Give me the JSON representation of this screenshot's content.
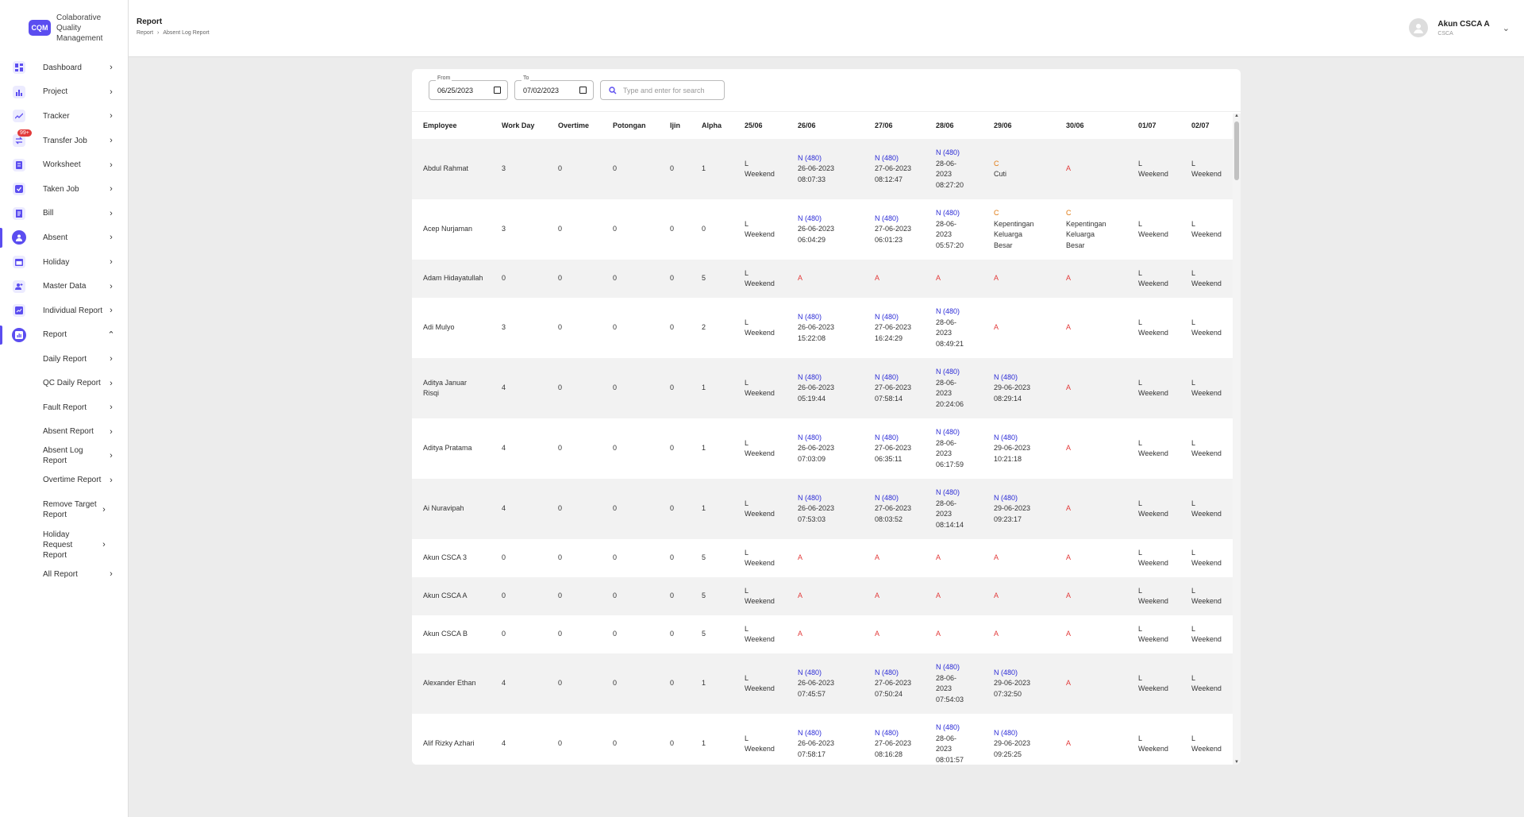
{
  "brand": {
    "logo": "CQM",
    "name_line1": "Colaborative",
    "name_line2": "Quality",
    "name_line3": "Management"
  },
  "menu": [
    {
      "label": "Dashboard",
      "icon": "dashboard-icon"
    },
    {
      "label": "Project",
      "icon": "bar-chart-icon"
    },
    {
      "label": "Tracker",
      "icon": "trend-line-icon"
    },
    {
      "label": "Transfer Job",
      "icon": "transfer-icon",
      "badge": "99+"
    },
    {
      "label": "Worksheet",
      "icon": "worksheet-icon"
    },
    {
      "label": "Taken Job",
      "icon": "check-box-icon"
    },
    {
      "label": "Bill",
      "icon": "bill-icon"
    },
    {
      "label": "Absent",
      "icon": "absent-icon"
    },
    {
      "label": "Holiday",
      "icon": "calendar-icon"
    },
    {
      "label": "Master Data",
      "icon": "add-user-icon"
    },
    {
      "label": "Individual Report",
      "icon": "individual-report-icon"
    },
    {
      "label": "Report",
      "icon": "report-icon"
    }
  ],
  "report_submenu": [
    "Daily Report",
    "QC Daily Report",
    "Fault Report",
    "Absent Report",
    "Absent Log Report",
    "Overtime Report",
    "Remove Target Report",
    "Holiday Request Report",
    "All Report"
  ],
  "header": {
    "title": "Report",
    "crumb1": "Report",
    "crumb_sep": "›",
    "crumb2": "Absent Log Report"
  },
  "user": {
    "name": "Akun CSCA A",
    "role": "CSCA"
  },
  "filters": {
    "from_label": "From",
    "from_value": "06/25/2023",
    "to_label": "To",
    "to_value": "07/02/2023",
    "search_placeholder": "Type and enter for search"
  },
  "table": {
    "columns": [
      "Employee",
      "Work Day",
      "Overtime",
      "Potongan",
      "Ijin",
      "Alpha",
      "25/06",
      "26/06",
      "27/06",
      "28/06",
      "29/06",
      "30/06",
      "01/07",
      "02/07"
    ],
    "rows": [
      {
        "name": "Abdul Rahmat",
        "work": "3",
        "ot": "0",
        "pot": "0",
        "ijin": "0",
        "alpha": "1",
        "days": [
          [
            "L",
            "Weekend"
          ],
          [
            "N (480)",
            "26-06-2023",
            "08:07:33"
          ],
          [
            "N (480)",
            "27-06-2023",
            "08:12:47"
          ],
          [
            "N (480)",
            "28-06-",
            "2023",
            "08:27:20"
          ],
          [
            "C",
            "Cuti"
          ],
          [
            "A"
          ],
          [
            "L",
            "Weekend"
          ],
          [
            "L",
            "Weekend"
          ]
        ]
      },
      {
        "name": "Acep Nurjaman",
        "work": "3",
        "ot": "0",
        "pot": "0",
        "ijin": "0",
        "alpha": "0",
        "days": [
          [
            "L",
            "Weekend"
          ],
          [
            "N (480)",
            "26-06-2023",
            "06:04:29"
          ],
          [
            "N (480)",
            "27-06-2023",
            "06:01:23"
          ],
          [
            "N (480)",
            "28-06-",
            "2023",
            "05:57:20"
          ],
          [
            "C",
            "Kepentingan",
            "Keluarga",
            "Besar"
          ],
          [
            "C",
            "Kepentingan",
            "Keluarga",
            "Besar"
          ],
          [
            "L",
            "Weekend"
          ],
          [
            "L",
            "Weekend"
          ]
        ]
      },
      {
        "name": "Adam Hidayatullah",
        "work": "0",
        "ot": "0",
        "pot": "0",
        "ijin": "0",
        "alpha": "5",
        "days": [
          [
            "L",
            "Weekend"
          ],
          [
            "A"
          ],
          [
            "A"
          ],
          [
            "A"
          ],
          [
            "A"
          ],
          [
            "A"
          ],
          [
            "L",
            "Weekend"
          ],
          [
            "L",
            "Weekend"
          ]
        ]
      },
      {
        "name": "Adi Mulyo",
        "work": "3",
        "ot": "0",
        "pot": "0",
        "ijin": "0",
        "alpha": "2",
        "days": [
          [
            "L",
            "Weekend"
          ],
          [
            "N (480)",
            "26-06-2023",
            "15:22:08"
          ],
          [
            "N (480)",
            "27-06-2023",
            "16:24:29"
          ],
          [
            "N (480)",
            "28-06-",
            "2023",
            "08:49:21"
          ],
          [
            "A"
          ],
          [
            "A"
          ],
          [
            "L",
            "Weekend"
          ],
          [
            "L",
            "Weekend"
          ]
        ]
      },
      {
        "name": "Aditya Januar Risqi",
        "work": "4",
        "ot": "0",
        "pot": "0",
        "ijin": "0",
        "alpha": "1",
        "days": [
          [
            "L",
            "Weekend"
          ],
          [
            "N (480)",
            "26-06-2023",
            "05:19:44"
          ],
          [
            "N (480)",
            "27-06-2023",
            "07:58:14"
          ],
          [
            "N (480)",
            "28-06-",
            "2023",
            "20:24:06"
          ],
          [
            "N (480)",
            "29-06-2023",
            "08:29:14"
          ],
          [
            "A"
          ],
          [
            "L",
            "Weekend"
          ],
          [
            "L",
            "Weekend"
          ]
        ]
      },
      {
        "name": "Aditya Pratama",
        "work": "4",
        "ot": "0",
        "pot": "0",
        "ijin": "0",
        "alpha": "1",
        "days": [
          [
            "L",
            "Weekend"
          ],
          [
            "N (480)",
            "26-06-2023",
            "07:03:09"
          ],
          [
            "N (480)",
            "27-06-2023",
            "06:35:11"
          ],
          [
            "N (480)",
            "28-06-",
            "2023",
            "06:17:59"
          ],
          [
            "N (480)",
            "29-06-2023",
            "10:21:18"
          ],
          [
            "A"
          ],
          [
            "L",
            "Weekend"
          ],
          [
            "L",
            "Weekend"
          ]
        ]
      },
      {
        "name": "Ai Nuravipah",
        "work": "4",
        "ot": "0",
        "pot": "0",
        "ijin": "0",
        "alpha": "1",
        "days": [
          [
            "L",
            "Weekend"
          ],
          [
            "N (480)",
            "26-06-2023",
            "07:53:03"
          ],
          [
            "N (480)",
            "27-06-2023",
            "08:03:52"
          ],
          [
            "N (480)",
            "28-06-",
            "2023",
            "08:14:14"
          ],
          [
            "N (480)",
            "29-06-2023",
            "09:23:17"
          ],
          [
            "A"
          ],
          [
            "L",
            "Weekend"
          ],
          [
            "L",
            "Weekend"
          ]
        ]
      },
      {
        "name": "Akun CSCA 3",
        "work": "0",
        "ot": "0",
        "pot": "0",
        "ijin": "0",
        "alpha": "5",
        "days": [
          [
            "L",
            "Weekend"
          ],
          [
            "A"
          ],
          [
            "A"
          ],
          [
            "A"
          ],
          [
            "A"
          ],
          [
            "A"
          ],
          [
            "L",
            "Weekend"
          ],
          [
            "L",
            "Weekend"
          ]
        ]
      },
      {
        "name": "Akun CSCA A",
        "work": "0",
        "ot": "0",
        "pot": "0",
        "ijin": "0",
        "alpha": "5",
        "days": [
          [
            "L",
            "Weekend"
          ],
          [
            "A"
          ],
          [
            "A"
          ],
          [
            "A"
          ],
          [
            "A"
          ],
          [
            "A"
          ],
          [
            "L",
            "Weekend"
          ],
          [
            "L",
            "Weekend"
          ]
        ]
      },
      {
        "name": "Akun CSCA B",
        "work": "0",
        "ot": "0",
        "pot": "0",
        "ijin": "0",
        "alpha": "5",
        "days": [
          [
            "L",
            "Weekend"
          ],
          [
            "A"
          ],
          [
            "A"
          ],
          [
            "A"
          ],
          [
            "A"
          ],
          [
            "A"
          ],
          [
            "L",
            "Weekend"
          ],
          [
            "L",
            "Weekend"
          ]
        ]
      },
      {
        "name": "Alexander Ethan",
        "work": "4",
        "ot": "0",
        "pot": "0",
        "ijin": "0",
        "alpha": "1",
        "days": [
          [
            "L",
            "Weekend"
          ],
          [
            "N (480)",
            "26-06-2023",
            "07:45:57"
          ],
          [
            "N (480)",
            "27-06-2023",
            "07:50:24"
          ],
          [
            "N (480)",
            "28-06-",
            "2023",
            "07:54:03"
          ],
          [
            "N (480)",
            "29-06-2023",
            "07:32:50"
          ],
          [
            "A"
          ],
          [
            "L",
            "Weekend"
          ],
          [
            "L",
            "Weekend"
          ]
        ]
      },
      {
        "name": "Alif Rizky Azhari",
        "work": "4",
        "ot": "0",
        "pot": "0",
        "ijin": "0",
        "alpha": "1",
        "days": [
          [
            "L",
            "Weekend"
          ],
          [
            "N (480)",
            "26-06-2023",
            "07:58:17"
          ],
          [
            "N (480)",
            "27-06-2023",
            "08:16:28"
          ],
          [
            "N (480)",
            "28-06-",
            "2023",
            "08:01:57"
          ],
          [
            "N (480)",
            "29-06-2023",
            "09:25:25"
          ],
          [
            "A"
          ],
          [
            "L",
            "Weekend"
          ],
          [
            "L",
            "Weekend"
          ]
        ]
      }
    ]
  },
  "colors": {
    "accent": "#5b4df0",
    "status_n": "#2b2bd6",
    "status_a": "#e23a3a",
    "status_c": "#e07a12"
  }
}
